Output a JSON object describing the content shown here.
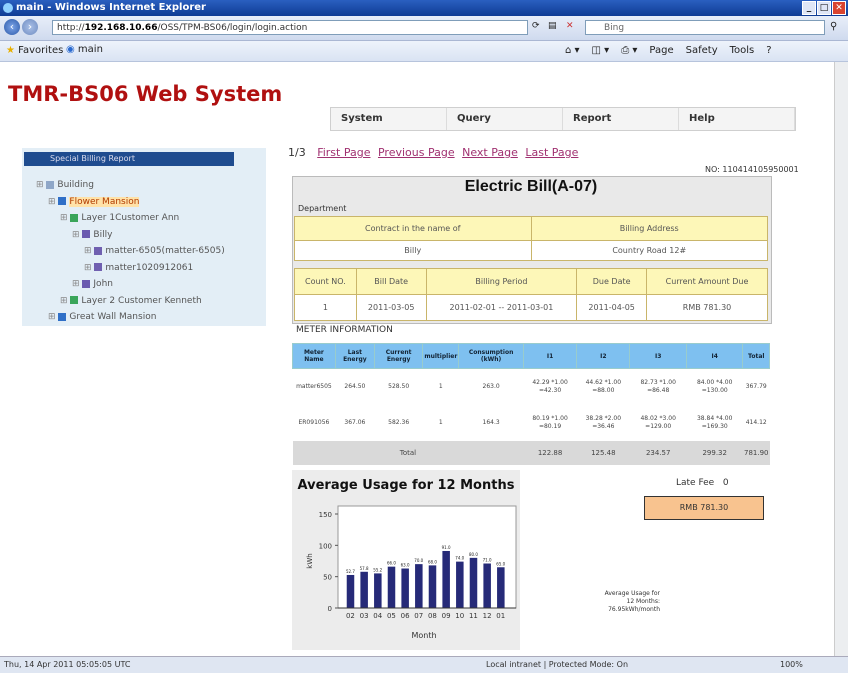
{
  "browser": {
    "window_title": "main - Windows Internet Explorer",
    "url_host": "192.168.10.66",
    "url_rest": "/OSS/TPM-BS06/login/login.action",
    "url_prefix": "http://",
    "search_placeholder": "Bing",
    "favorites_label": "Favorites",
    "tab_label": "main",
    "cmd_page": "Page",
    "cmd_safety": "Safety",
    "cmd_tools": "Tools",
    "status_left": "Thu, 14 Apr 2011 05:05:05 UTC",
    "status_zone": "Local intranet | Protected Mode: On",
    "status_zoom": "100%"
  },
  "app": {
    "title": "TMR-BS06 Web System",
    "menu": [
      "System",
      "Query",
      "Report",
      "Help"
    ]
  },
  "tree": {
    "header": "Special Billing Report",
    "nodes": [
      {
        "label": "Building",
        "level": 0,
        "color": "#8fa7c8"
      },
      {
        "label": "Flower Mansion",
        "level": 1,
        "color": "#2f6fc7",
        "selected": true
      },
      {
        "label": "Layer 1Customer Ann",
        "level": 2,
        "color": "#3aa55a"
      },
      {
        "label": "Billy",
        "level": 3,
        "color": "#6a5ab0"
      },
      {
        "label": "matter-6505(matter-6505)",
        "level": 4,
        "color": "#7060b0"
      },
      {
        "label": "matter1020912061",
        "level": 4,
        "color": "#7060b0"
      },
      {
        "label": "John",
        "level": 3,
        "color": "#6a5ab0"
      },
      {
        "label": "Layer 2 Customer Kenneth",
        "level": 2,
        "color": "#3aa55a"
      },
      {
        "label": "Great Wall Mansion",
        "level": 1,
        "color": "#2f6fc7"
      }
    ]
  },
  "pager": {
    "counter": "1/3",
    "first": "First Page",
    "previous": "Previous Page",
    "next": "Next Page",
    "last": "Last Page"
  },
  "bill": {
    "number_label": "NO:",
    "number": "110414105950001",
    "title": "Electric Bill(A-07)",
    "department_label": "Department",
    "contract_label": "Contract in the name of",
    "contract_value": "Billy",
    "address_label": "Billing Address",
    "address_value": "Country Road 12#",
    "hdr_account": "Count NO.",
    "hdr_billdate": "Bill Date",
    "hdr_period": "Billing Period",
    "hdr_duedate": "Due Date",
    "hdr_current": "Current Amount Due",
    "val_account": "1",
    "val_billdate": "2011-03-05",
    "val_period": "2011-02-01 -- 2011-03-01",
    "val_duedate": "2011-04-05",
    "val_current": "RMB 781.30"
  },
  "meter": {
    "section_label": "METER INFORMATION",
    "headers": [
      "Meter Name",
      "Last Energy",
      "Current Energy",
      "multiplier",
      "Consumption (kWh)",
      "I1",
      "I2",
      "I3",
      "I4",
      "Total"
    ],
    "rows": [
      [
        "matter6505",
        "264.50",
        "528.50",
        "1",
        "263.0",
        "42.29 *1.00 =42.30",
        "44.62 *1.00 =88.00",
        "82.73 *1.00 =86.48",
        "84.00 *4.00 =130.00",
        "367.79"
      ],
      [
        "ER091056",
        "367.06",
        "582.36",
        "1",
        "164.3",
        "80.19 *1.00 =80.19",
        "38.28 *2.00 =36.46",
        "48.02 *3.00 =129.00",
        "38.84 *4.00 =169.30",
        "414.12"
      ]
    ],
    "total_label": "Total",
    "totals": [
      "122.88",
      "125.48",
      "234.57",
      "299.32",
      "781.90"
    ]
  },
  "chart_data": {
    "type": "bar",
    "title": "Average Usage for 12 Months",
    "xlabel": "Month",
    "ylabel": "kWh",
    "categories": [
      "02",
      "03",
      "04",
      "05",
      "06",
      "07",
      "08",
      "09",
      "10",
      "11",
      "12",
      "01"
    ],
    "values": [
      52.7,
      57.8,
      55.2,
      66.0,
      63.0,
      70.0,
      68.0,
      91.0,
      74.0,
      80.0,
      71.0,
      65.0
    ],
    "ylim": [
      0,
      150
    ],
    "yticks": [
      "0",
      "50",
      "100",
      "150"
    ]
  },
  "summary": {
    "late_fee_label": "Late Fee",
    "late_fee_value": "0",
    "due_total": "RMB 781.30",
    "avg_line1": "Average Usage for",
    "avg_line2": "12 Months:",
    "avg_line3": "76.95kWh/month"
  }
}
